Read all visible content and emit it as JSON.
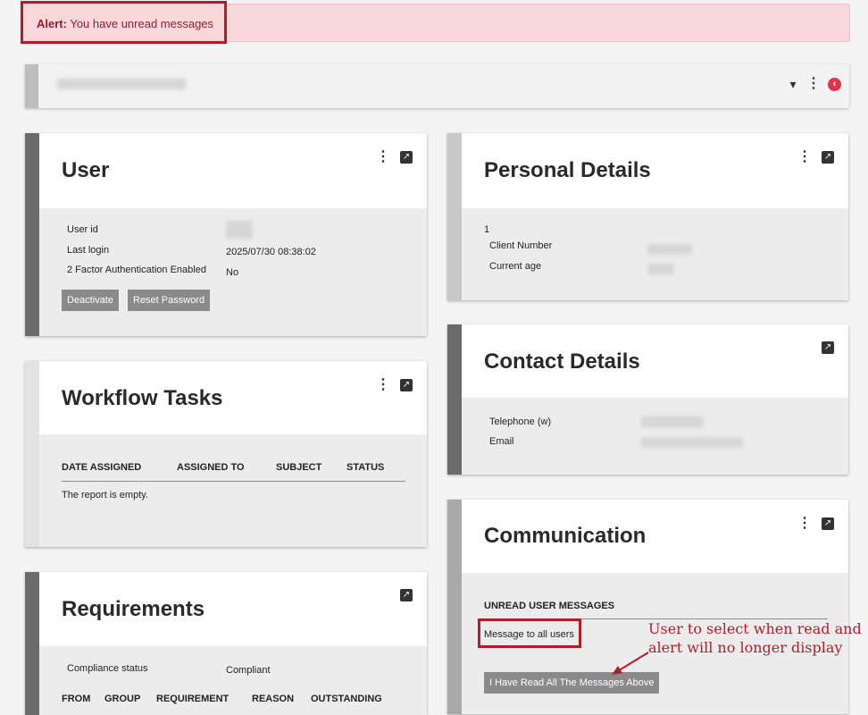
{
  "alert": {
    "prefix": "Alert:",
    "message": "You have unread messages"
  },
  "topbar": {
    "icons": [
      "double-chevron-down-icon",
      "kebab-menu-icon",
      "close-circle-icon"
    ]
  },
  "user_card": {
    "title": "User",
    "rows": [
      {
        "label": "User id",
        "value": ""
      },
      {
        "label": "Last login",
        "value": "2025/07/30 08:38:02"
      },
      {
        "label": "2 Factor Authentication Enabled",
        "value": "No"
      }
    ],
    "buttons": {
      "deactivate": "Deactivate",
      "reset_password": "Reset Password"
    }
  },
  "workflow_card": {
    "title": "Workflow Tasks",
    "columns": [
      "DATE ASSIGNED",
      "ASSIGNED TO",
      "SUBJECT",
      "STATUS"
    ],
    "empty_text": "The report is empty."
  },
  "requirements_card": {
    "title": "Requirements",
    "compliance_label": "Compliance status",
    "compliance_value": "Compliant",
    "columns": [
      "FROM",
      "GROUP",
      "REQUIREMENT",
      "REASON",
      "OUTSTANDING"
    ]
  },
  "personal_card": {
    "title": "Personal Details",
    "index": "1",
    "rows": [
      {
        "label": "Client Number"
      },
      {
        "label": "Current age"
      }
    ]
  },
  "contact_card": {
    "title": "Contact Details",
    "rows": [
      {
        "label": "Telephone (w)"
      },
      {
        "label": "Email"
      }
    ]
  },
  "communication_card": {
    "title": "Communication",
    "section_heading": "UNREAD USER MESSAGES",
    "message": "Message to all users",
    "read_button": "I Have Read All The Messages Above"
  },
  "annotation": {
    "line1": "User to select when read and",
    "line2": "alert will no longer display",
    "color": "#b21d2a"
  },
  "colors": {
    "accent_dark": "#6b6b6b",
    "accent_light": "#c8c8c8",
    "alert_bg": "#f8d7da"
  }
}
